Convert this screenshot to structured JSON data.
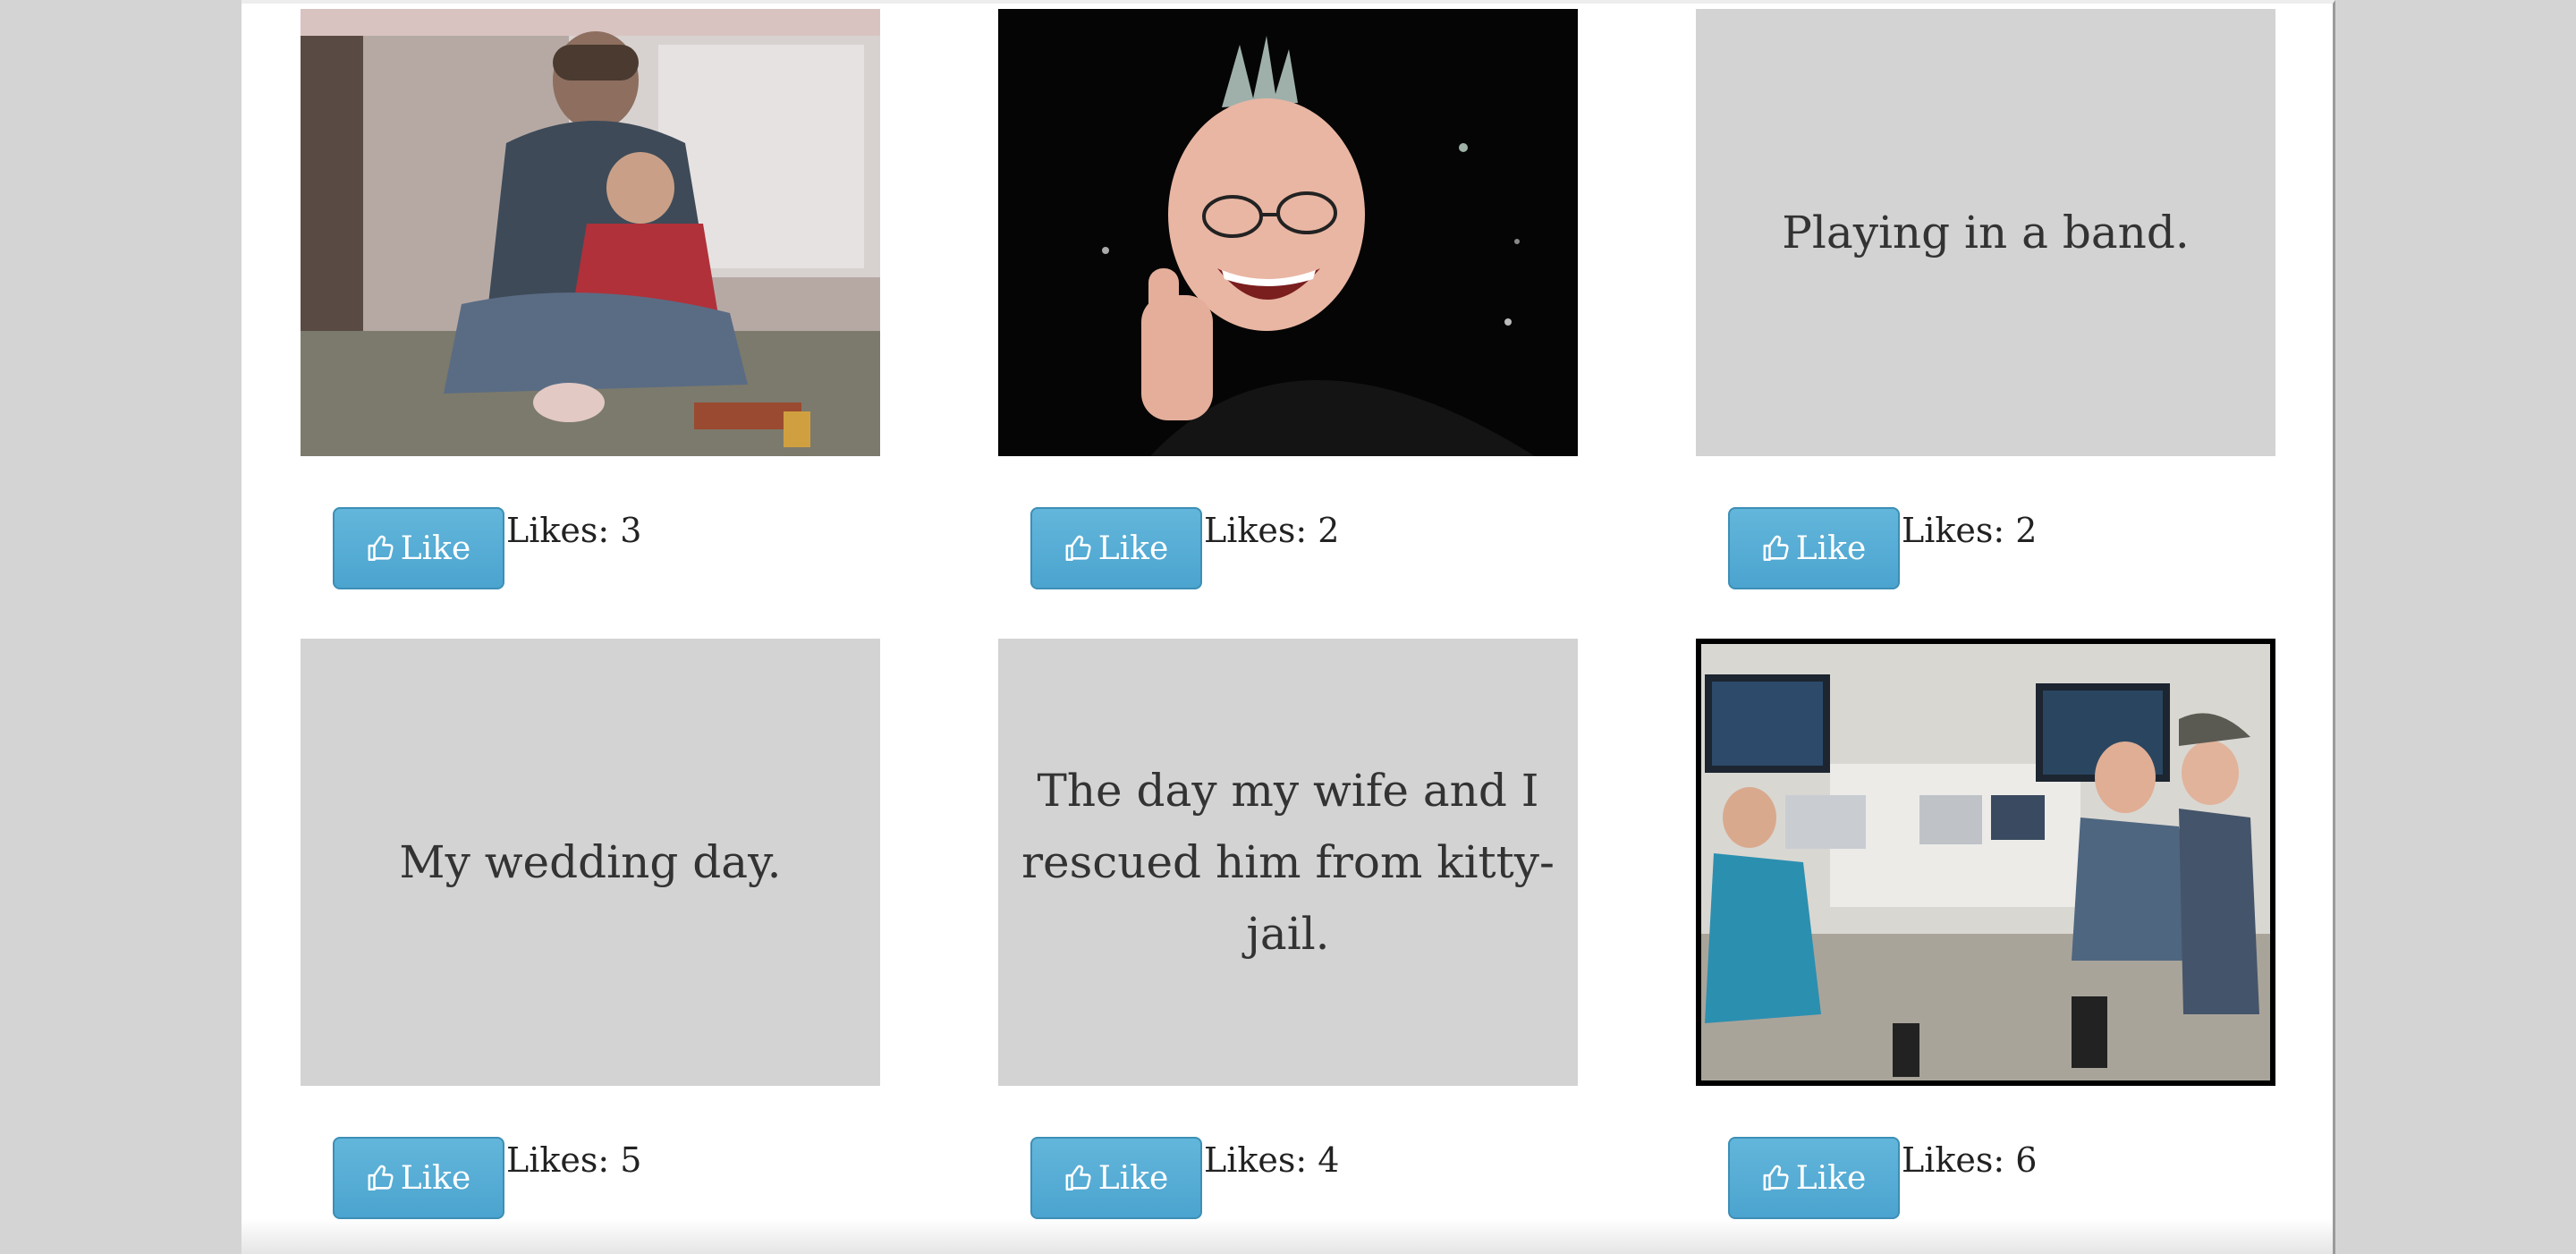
{
  "gallery": {
    "cards": [
      {
        "image": "photo-father-and-child",
        "caption": "",
        "button_label": "Like",
        "likes_label": "Likes: 3"
      },
      {
        "image": "photo-man-with-mohawk-thumbs-up",
        "caption": "",
        "button_label": "Like",
        "likes_label": "Likes: 2"
      },
      {
        "image": "",
        "caption": "Playing in a band.",
        "button_label": "Like",
        "likes_label": "Likes: 2"
      },
      {
        "image": "",
        "caption": "My wedding day.",
        "button_label": "Like",
        "likes_label": "Likes: 5"
      },
      {
        "image": "",
        "caption": "The day my wife and I rescued him from kitty-jail.",
        "button_label": "Like",
        "likes_label": "Likes: 4"
      },
      {
        "image": "photo-team-at-desks",
        "caption": "",
        "button_label": "Like",
        "likes_label": "Likes: 6"
      }
    ]
  },
  "icons": {
    "like_button_icon": "thumbs-up-icon"
  },
  "colors": {
    "page_background": "#d4d4d4",
    "content_background": "#ffffff",
    "placeholder_background": "#d3d3d3",
    "like_button": "#55acd4"
  }
}
